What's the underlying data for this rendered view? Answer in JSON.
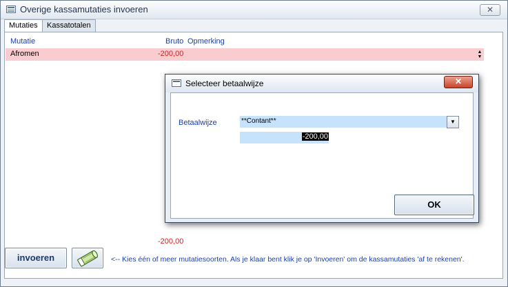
{
  "window": {
    "title": "Overige kassamutaties invoeren",
    "close_label": "✕"
  },
  "tabs": [
    {
      "label": "Mutaties"
    },
    {
      "label": "Kassatotalen"
    }
  ],
  "columns": {
    "mutatie": "Mutatie",
    "bruto": "Bruto",
    "opmerking": "Opmerking"
  },
  "rows": [
    {
      "mutatie": "Afromen",
      "bruto": "-200,00",
      "opmerking": ""
    }
  ],
  "total": "-200,00",
  "buttons": {
    "invoeren": "invoeren"
  },
  "hint": "<-- Kies één of meer mutatiesoorten. Als je klaar bent klik je op 'Invoeren' om de kassamutaties 'af te rekenen'.",
  "dialog": {
    "title": "Selecteer betaalwijze",
    "close_label": "✕",
    "label": "Betaalwijze",
    "selected": "**Contant**",
    "amount": "-200,00",
    "ok_label": "OK"
  },
  "colors": {
    "row_highlight": "#f9cdd0",
    "amount_red": "#e01818",
    "label_blue": "#1b3fa8",
    "field_bg": "#c7e3fb"
  }
}
